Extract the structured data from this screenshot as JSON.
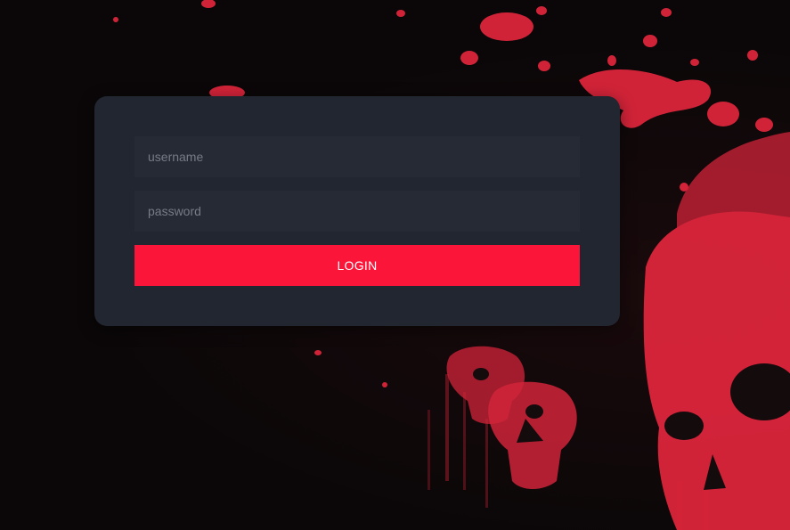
{
  "login": {
    "username_placeholder": "username",
    "password_placeholder": "password",
    "button_label": "LOGIN"
  },
  "background": {
    "art": "blood-splatter-skull",
    "accent_color": "#e8283f"
  }
}
